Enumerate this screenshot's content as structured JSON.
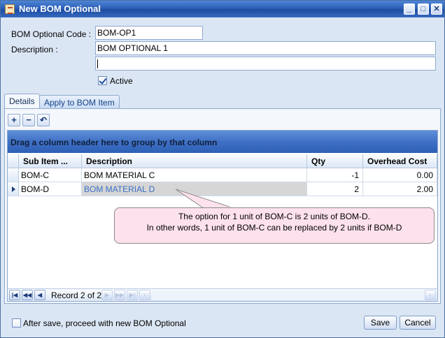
{
  "window": {
    "title": "New BOM Optional",
    "controls": {
      "minimize": "_",
      "maximize": "□",
      "close": "✕"
    }
  },
  "form": {
    "code_label": "BOM Optional Code :",
    "code_value": "BOM-OP1",
    "description_label": "Description :",
    "description_value": "BOM OPTIONAL 1",
    "description2_value": "",
    "active_label": "Active",
    "active_checked": true
  },
  "tabs": [
    {
      "label": "Details",
      "active": true
    },
    {
      "label": "Apply to BOM Item",
      "active": false
    }
  ],
  "toolbar": {
    "add_icon": "plus-icon",
    "remove_icon": "minus-icon",
    "undo_icon": "undo-icon"
  },
  "grid": {
    "group_panel_text": "Drag a column header here to group by that column",
    "columns": [
      "Sub Item ...",
      "Description",
      "Qty",
      "Overhead Cost"
    ],
    "rows": [
      {
        "sub_item": "BOM-C",
        "description": "BOM MATERIAL C",
        "qty": "-1",
        "overhead_cost": "0.00"
      },
      {
        "sub_item": "BOM-D",
        "description": "BOM MATERIAL D",
        "qty": "2",
        "overhead_cost": "2.00"
      }
    ],
    "current_row": 1
  },
  "callout": {
    "line1": "The option for 1 unit of BOM-C is 2 units of BOM-D.",
    "line2": "In other words, 1 unit of BOM-C can be replaced by 2 units if BOM-D"
  },
  "navigator": {
    "record_text": "Record 2 of 2"
  },
  "footer": {
    "proceed_label": "After save, proceed with new BOM Optional",
    "save_label": "Save",
    "cancel_label": "Cancel"
  },
  "colors": {
    "titlebar": "#2b5fb8",
    "window_bg": "#dbe6f4",
    "group_panel": "#3f70c4",
    "callout_bg": "#fde1ec",
    "selected_text": "#3a6fc4"
  }
}
